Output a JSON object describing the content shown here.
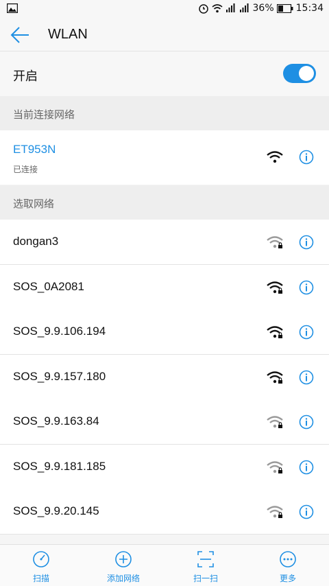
{
  "status_bar": {
    "battery": "36%",
    "time": "15:34"
  },
  "header": {
    "title": "WLAN"
  },
  "toggle": {
    "label": "开启",
    "on": true
  },
  "current_section": {
    "label": "当前连接网络"
  },
  "current_network": {
    "name": "ET953N",
    "status": "已连接"
  },
  "available_section": {
    "label": "选取网络"
  },
  "networks": [
    {
      "name": "dongan3"
    },
    {
      "name": "SOS_0A2081"
    },
    {
      "name": "SOS_9.9.106.194"
    },
    {
      "name": "SOS_9.9.157.180"
    },
    {
      "name": "SOS_9.9.163.84"
    },
    {
      "name": "SOS_9.9.181.185"
    },
    {
      "name": "SOS_9.9.20.145"
    }
  ],
  "toolbar": {
    "scan": "扫描",
    "add_network": "添加网络",
    "scan_code": "扫一扫",
    "more": "更多"
  },
  "colors": {
    "accent": "#1e8fe3",
    "section_bg": "#eeeeee"
  }
}
